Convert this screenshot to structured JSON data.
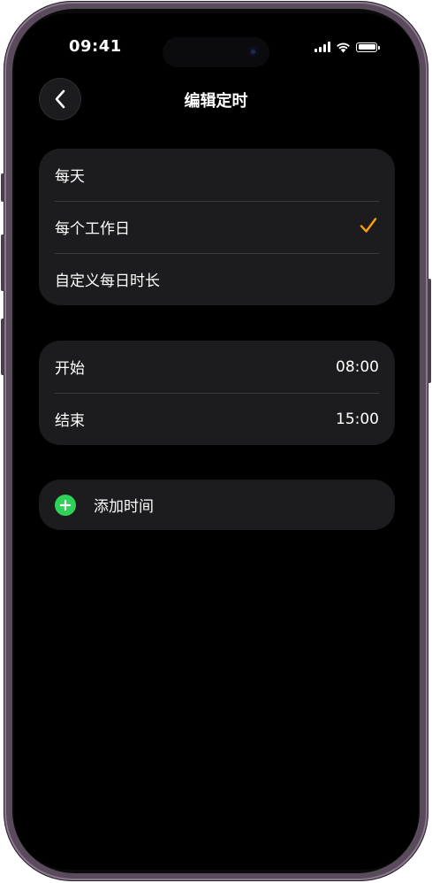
{
  "status_bar": {
    "time": "09:41"
  },
  "nav": {
    "title": "编辑定时"
  },
  "repeat_options": [
    {
      "label": "每天",
      "selected": false
    },
    {
      "label": "每个工作日",
      "selected": true
    },
    {
      "label": "自定义每日时长",
      "selected": false
    }
  ],
  "schedule": {
    "start_label": "开始",
    "start_value": "08:00",
    "end_label": "结束",
    "end_value": "15:00"
  },
  "add_time": {
    "label": "添加时间"
  },
  "colors": {
    "accent_check": "#ff9f0a",
    "add_green": "#30d158",
    "cell_bg": "#1c1c1e"
  },
  "icons": [
    "back-chevron-icon",
    "checkmark-icon",
    "plus-circle-icon",
    "cellular-signal-icon",
    "wifi-icon",
    "battery-icon"
  ]
}
